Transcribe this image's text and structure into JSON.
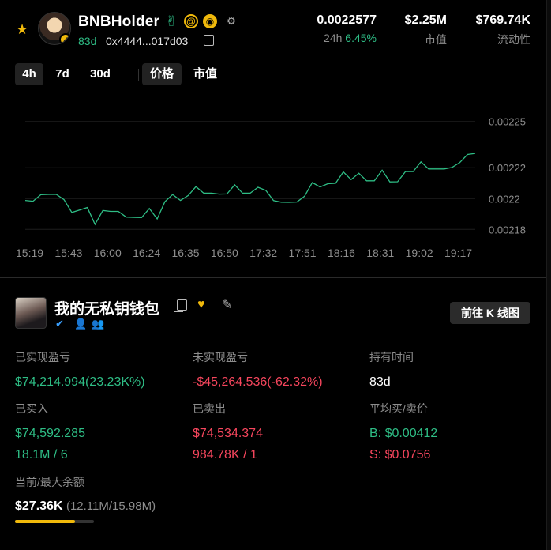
{
  "header": {
    "name": "BNBHolder",
    "days": "83d",
    "address": "0x4444...017d03",
    "stats": [
      {
        "value": "0.0022577",
        "label": "24h",
        "change": "6.45%"
      },
      {
        "value": "$2.25M",
        "label": "市值"
      },
      {
        "value": "$769.74K",
        "label": "流动性"
      }
    ]
  },
  "tabs": {
    "range": [
      "4h",
      "7d",
      "30d"
    ],
    "range_active": 0,
    "metric": [
      "价格",
      "市值"
    ],
    "metric_active": 0
  },
  "chart_data": {
    "type": "line",
    "color": "#2ebd85",
    "x_ticks": [
      "15:19",
      "15:43",
      "16:00",
      "16:24",
      "16:35",
      "16:50",
      "17:32",
      "17:51",
      "18:16",
      "18:31",
      "19:02",
      "19:17"
    ],
    "y_ticks": [
      "0.00225",
      "0.00222",
      "0.0022",
      "0.00218"
    ],
    "y_tick_values": [
      0.00225,
      0.00222,
      0.0022,
      0.00218
    ],
    "ylim": [
      0.002174,
      0.002256
    ],
    "values": [
      0.0021988,
      0.0021983,
      0.0022025,
      0.0022027,
      0.0022027,
      0.0021993,
      0.002191,
      0.0021926,
      0.0021942,
      0.0021833,
      0.0021923,
      0.0021917,
      0.0021917,
      0.002188,
      0.0021878,
      0.0021877,
      0.0021936,
      0.0021868,
      0.002198,
      0.0022026,
      0.0021988,
      0.002202,
      0.0022077,
      0.0022035,
      0.0022035,
      0.0022029,
      0.002203,
      0.0022089,
      0.0022035,
      0.0022035,
      0.0022073,
      0.0022053,
      0.0021987,
      0.0021977,
      0.0021976,
      0.0021978,
      0.0022015,
      0.0022104,
      0.0022075,
      0.0022096,
      0.0022099,
      0.0022173,
      0.0022123,
      0.0022164,
      0.0022115,
      0.0022115,
      0.0022184,
      0.0022108,
      0.0022109,
      0.0022175,
      0.0022175,
      0.0022238,
      0.0022192,
      0.0022192,
      0.0022192,
      0.0022202,
      0.0022233,
      0.0022286,
      0.0022293
    ]
  },
  "wallet": {
    "name": "我的无私钥钱包",
    "kline_button": "前往 K 线图"
  },
  "metrics": {
    "realized_label": "已实现盈亏",
    "realized_value": "$74,214.994(23.23K%)",
    "unrealized_label": "未实现盈亏",
    "unrealized_value": "-$45,264.536(-62.32%)",
    "hold_label": "持有时间",
    "hold_value": "83d",
    "bought_label": "已买入",
    "bought_value": "$74,592.285",
    "bought_count": "18.1M / 6",
    "sold_label": "已卖出",
    "sold_value": "$74,534.374",
    "sold_count": "984.78K / 1",
    "avg_label": "平均买/卖价",
    "avg_buy": "B: $0.00412",
    "avg_sell": "S: $0.0756",
    "balance_label": "当前/最大余额",
    "balance_value": "$27.36K",
    "balance_detail": "(12.11M/15.98M)",
    "balance_ratio": 0.757
  },
  "colors": {
    "positive": "#2ebd85",
    "negative": "#f6465d",
    "accent": "#f0b90b"
  }
}
